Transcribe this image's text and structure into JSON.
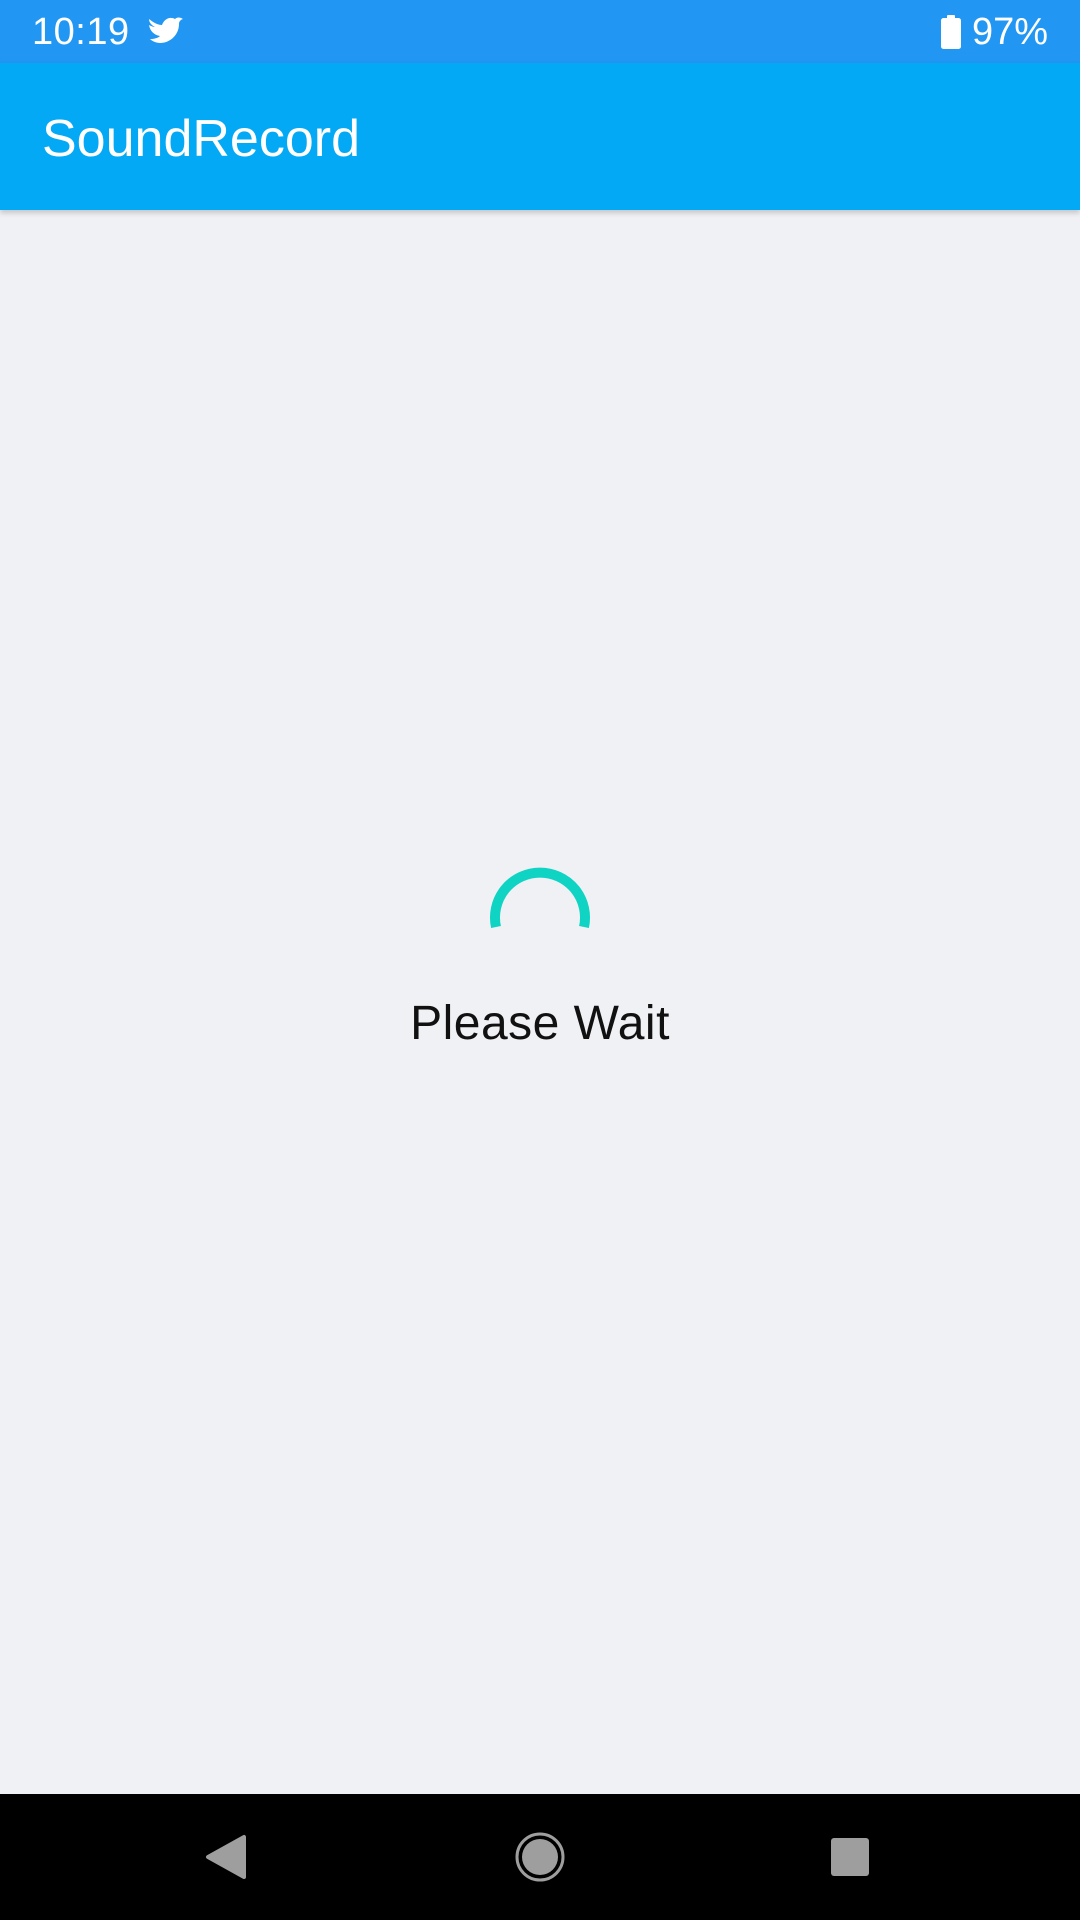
{
  "status_bar": {
    "time": "10:19",
    "app_icon": "bird-icon",
    "battery_icon": "battery-icon",
    "battery_level": "97%"
  },
  "app_bar": {
    "title": "SoundRecord"
  },
  "loader": {
    "spinner_icon": "progress-spinner-icon",
    "message": "Please Wait",
    "spinner_color": "#0fd3c3"
  },
  "nav_bar": {
    "back_icon": "back-icon",
    "home_icon": "home-icon",
    "recents_icon": "recents-icon"
  },
  "colors": {
    "status_bar": "#2196f3",
    "app_bar": "#03a9f4",
    "background": "#eff1f5",
    "nav_bar": "#000000"
  }
}
